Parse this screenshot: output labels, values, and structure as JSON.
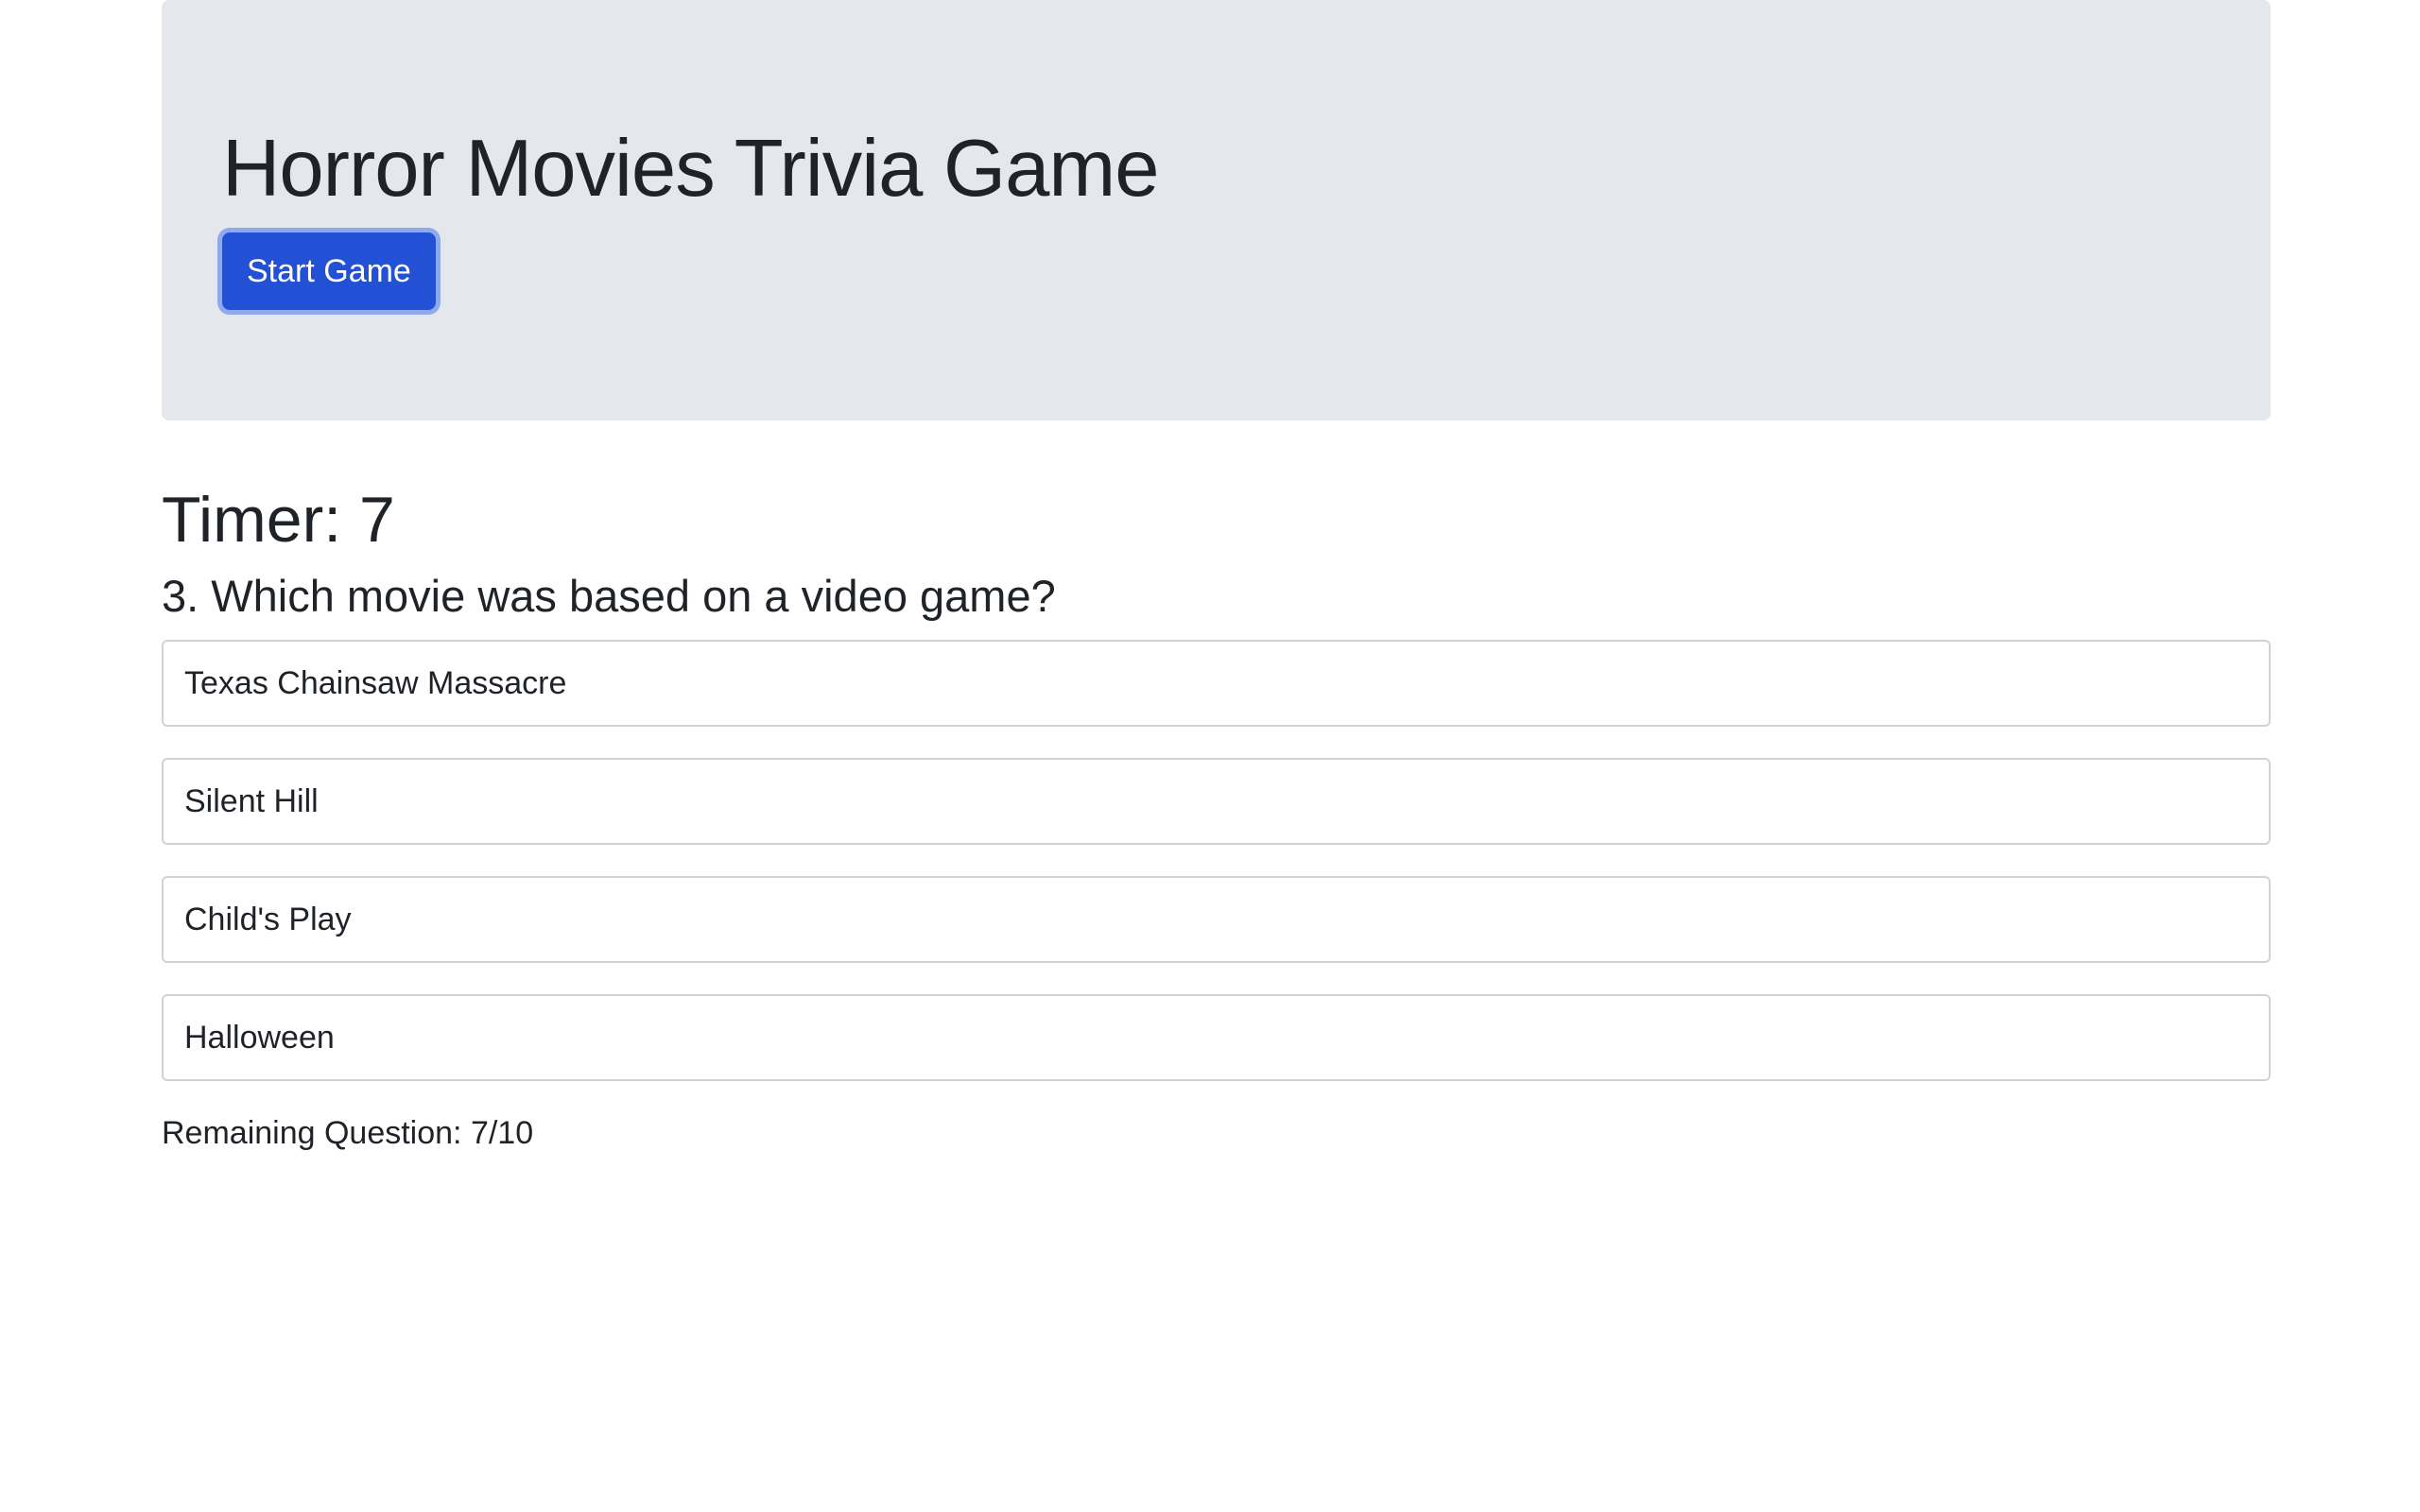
{
  "header": {
    "title": "Horror Movies Trivia Game",
    "start_button_label": "Start Game"
  },
  "game": {
    "timer_label": "Timer: ",
    "timer_value": "7",
    "question": "3. Which movie was based on a video game?",
    "answers": [
      "Texas Chainsaw Massacre",
      "Silent Hill",
      "Child's Play",
      "Halloween"
    ],
    "remaining_label": "Remaining Question: ",
    "remaining_value": "7/10"
  },
  "colors": {
    "jumbotron_bg": "#e4e7eb",
    "primary_button": "#2351d6",
    "button_focus_ring": "#8fa9ef",
    "answer_border": "#cfd3d8"
  }
}
